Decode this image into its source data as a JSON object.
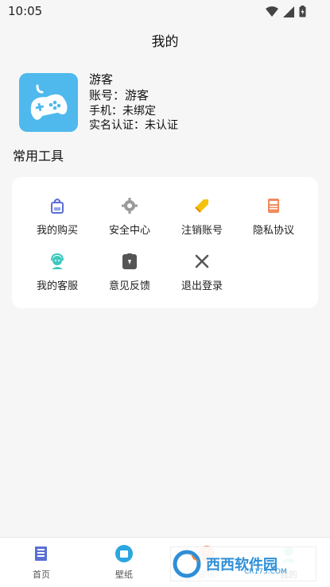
{
  "status_bar": {
    "time": "10:05",
    "icons": [
      "wifi-icon",
      "signal-icon",
      "battery-icon"
    ]
  },
  "header": {
    "title": "我的"
  },
  "profile": {
    "nickname": "游客",
    "account": "账号：游客",
    "phone": "手机：未绑定",
    "verification": "实名认证：未认证",
    "avatar_icon": "gamepad-icon",
    "avatar_color": "#4fb9ee"
  },
  "tools": {
    "title": "常用工具",
    "items": [
      {
        "label": "我的购买",
        "icon": "bag-icon",
        "color": "#5b6fd6"
      },
      {
        "label": "安全中心",
        "icon": "gear-icon",
        "color": "#9a9a9a"
      },
      {
        "label": "注销账号",
        "icon": "tag-icon",
        "color": "#f4c20d"
      },
      {
        "label": "隐私协议",
        "icon": "document-new-icon",
        "color": "#f08a5d"
      },
      {
        "label": "我的客服",
        "icon": "headset-icon",
        "color": "#3ec9c0"
      },
      {
        "label": "意见反馈",
        "icon": "clipboard-icon",
        "color": "#555555"
      },
      {
        "label": "退出登录",
        "icon": "close-icon",
        "color": "#555555"
      }
    ]
  },
  "bottom_nav": {
    "items": [
      {
        "label": "首页",
        "icon": "news-icon",
        "active": false
      },
      {
        "label": "壁纸",
        "icon": "wallpaper-icon",
        "active": false
      },
      {
        "label": "资讯",
        "icon": "info-icon",
        "active": false
      },
      {
        "label": "我的",
        "icon": "profile-icon",
        "active": true
      }
    ]
  },
  "watermark": {
    "brand": "西西软件园",
    "url": "CR173.COM"
  }
}
